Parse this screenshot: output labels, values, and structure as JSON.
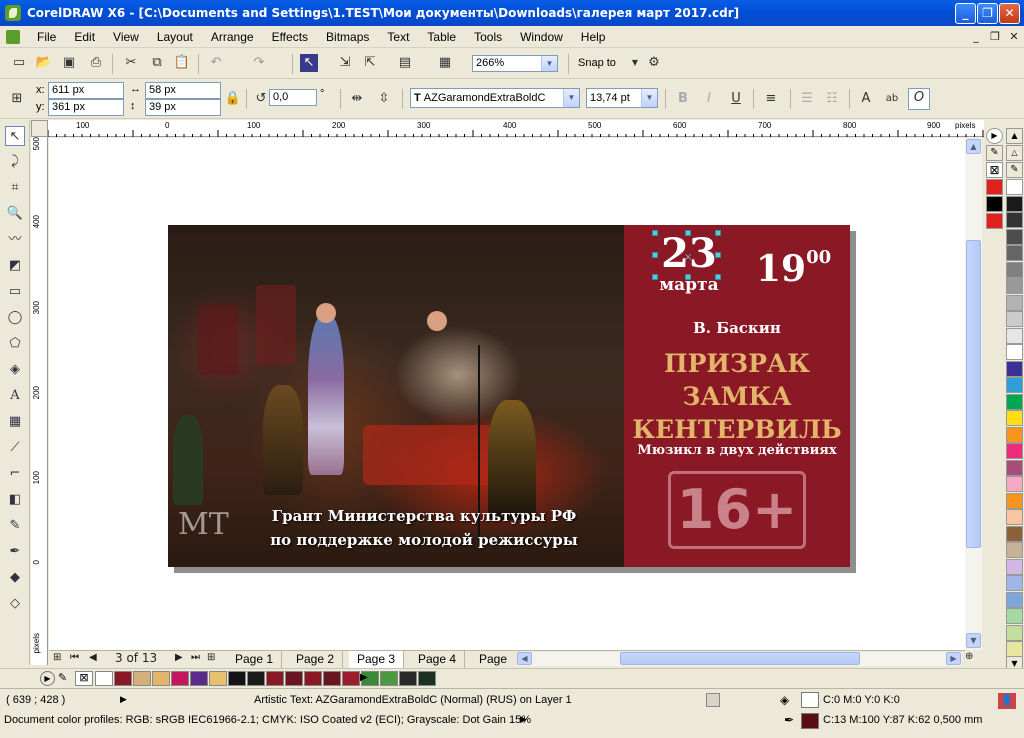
{
  "window": {
    "title": "CorelDRAW X6 - [C:\\Documents and Settings\\1.TEST\\Мои документы\\Downloads\\галерея март 2017.cdr]",
    "min_label": "_",
    "max_label": "❐",
    "close_label": "✕"
  },
  "menu": [
    "File",
    "Edit",
    "View",
    "Layout",
    "Arrange",
    "Effects",
    "Bitmaps",
    "Text",
    "Table",
    "Tools",
    "Window",
    "Help"
  ],
  "toolbar": {
    "zoom": "266%",
    "snap_to": "Snap to"
  },
  "propertybar": {
    "x_label": "x:",
    "y_label": "y:",
    "x_value": "611 px",
    "y_value": "361 px",
    "width": "58 px",
    "height": "39 px",
    "angle": "0,0",
    "degree": "°",
    "font_name": "AZGaramondExtraBoldC",
    "font_size": "13,74 pt"
  },
  "ruler": {
    "unit": "pixels",
    "h_ticks": [
      "100",
      "0",
      "100",
      "200",
      "300",
      "400",
      "500",
      "600",
      "700",
      "800",
      "900"
    ],
    "v_ticks": [
      "500",
      "400",
      "300",
      "200",
      "100",
      "0"
    ],
    "v_unit": "pixels"
  },
  "banner": {
    "day": "23",
    "month": "марта",
    "time_hour": "19",
    "time_min": "00",
    "author": "В. Баскин",
    "title_lines": [
      "ПРИЗРАК",
      "ЗАМКА",
      "КЕНТЕРВИЛЬ"
    ],
    "subtitle": "Мюзикл в двух действиях",
    "age": "16+",
    "grant_line1": "Грант Министерства культуры РФ",
    "grant_line2": "по поддержке молодой режиссуры",
    "logo_letters": "МТ",
    "colors": {
      "burgundy": "#8a1825",
      "gold": "#e3b56a",
      "selection": "#5fc7d6"
    }
  },
  "pages": {
    "counter": "3 of 13",
    "tabs": [
      "Page 1",
      "Page 2",
      "Page 3",
      "Page 4",
      "Page"
    ],
    "active": "Page 3"
  },
  "palette_colors": [
    "#e0201c",
    "#000000",
    "#e0201c",
    "#ffffff",
    "#1a1a1a",
    "#333333",
    "#4d4d4d",
    "#666666",
    "#808080",
    "#999999",
    "#b3b3b3",
    "#cccccc",
    "#e6e6e6",
    "#ffffff",
    "#3a3096",
    "#2f9fd7",
    "#00a651",
    "#ffde17",
    "#f7941d",
    "#ee2a7b",
    "#a64d79",
    "#f6a7c1",
    "#f7941d",
    "#fbc4a0",
    "#8c6239",
    "#c7b299",
    "#d2b6e6",
    "#9fb7e8",
    "#7ca7d8",
    "#a5d9a2",
    "#c4df9b",
    "#e6e6a0"
  ],
  "doc_palette": [
    "#ffffff",
    "#8a1825",
    "#d2b07a",
    "#e3b56a",
    "#c4165c",
    "#5b2a8a",
    "#e6c06a",
    "#141414",
    "#1a1a1a",
    "#8a1825",
    "#6b1520",
    "#8a1825",
    "#6b1520",
    "#9a1e2e",
    "#3a8a3a",
    "#4a9a40",
    "#2a2a2a",
    "#1a3020"
  ],
  "status": {
    "coords": "( 639 ; 428 )",
    "object_info": "Artistic Text: AZGaramondExtraBoldC (Normal) (RUS) on Layer 1",
    "color_profiles": "Document color profiles: RGB: sRGB IEC61966-2.1; CMYK: ISO Coated v2 (ECI); Grayscale: Dot Gain 15%",
    "fill_info": "C:0 M:0 Y:0 K:0",
    "outline_info": "C:13 M:100 Y:87 K:62  0,500 mm",
    "outline_color": "#5a0e14"
  }
}
